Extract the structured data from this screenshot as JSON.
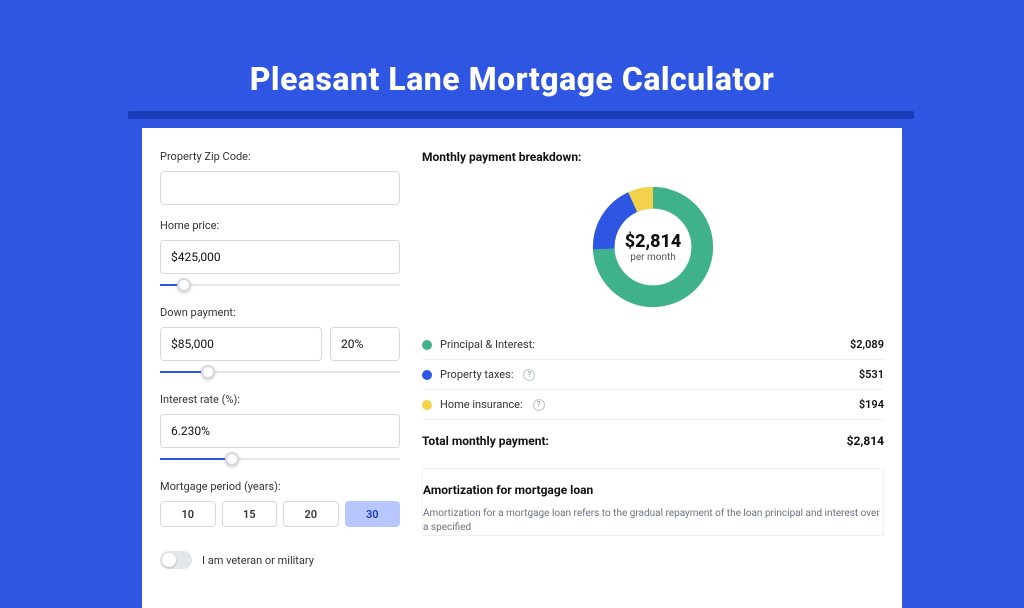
{
  "page": {
    "title": "Pleasant Lane Mortgage Calculator"
  },
  "colors": {
    "principal": "#3fb28b",
    "taxes": "#2f55e3",
    "insurance": "#f2d24a",
    "brand": "#2f55e3"
  },
  "form": {
    "zip_label": "Property Zip Code:",
    "zip_value": "",
    "home_price_label": "Home price:",
    "home_price_value": "$425,000",
    "home_price_slider_pct": 10,
    "down_payment_label": "Down payment:",
    "down_payment_value": "$85,000",
    "down_payment_pct_value": "20%",
    "down_payment_slider_pct": 20,
    "interest_label": "Interest rate (%):",
    "interest_value": "6.230%",
    "interest_slider_pct": 30,
    "period_label": "Mortgage period (years):",
    "periods": [
      "10",
      "15",
      "20",
      "30"
    ],
    "period_selected": "30",
    "veteran_label": "I am veteran or military",
    "veteran_on": false
  },
  "breakdown": {
    "title": "Monthly payment breakdown:",
    "donut_amount": "$2,814",
    "donut_sub": "per month",
    "rows": [
      {
        "key": "principal",
        "label": "Principal & Interest:",
        "value": "$2,089",
        "info": false
      },
      {
        "key": "taxes",
        "label": "Property taxes:",
        "value": "$531",
        "info": true
      },
      {
        "key": "insurance",
        "label": "Home insurance:",
        "value": "$194",
        "info": true
      }
    ],
    "total_label": "Total monthly payment:",
    "total_value": "$2,814"
  },
  "amort": {
    "title": "Amortization for mortgage loan",
    "text": "Amortization for a mortgage loan refers to the gradual repayment of the loan principal and interest over a specified"
  },
  "chart_data": {
    "type": "pie",
    "title": "Monthly payment breakdown",
    "categories": [
      "Principal & Interest",
      "Property taxes",
      "Home insurance"
    ],
    "values": [
      2089,
      531,
      194
    ],
    "colors": [
      "#3fb28b",
      "#2f55e3",
      "#f2d24a"
    ],
    "center_label": "$2,814 per month"
  }
}
